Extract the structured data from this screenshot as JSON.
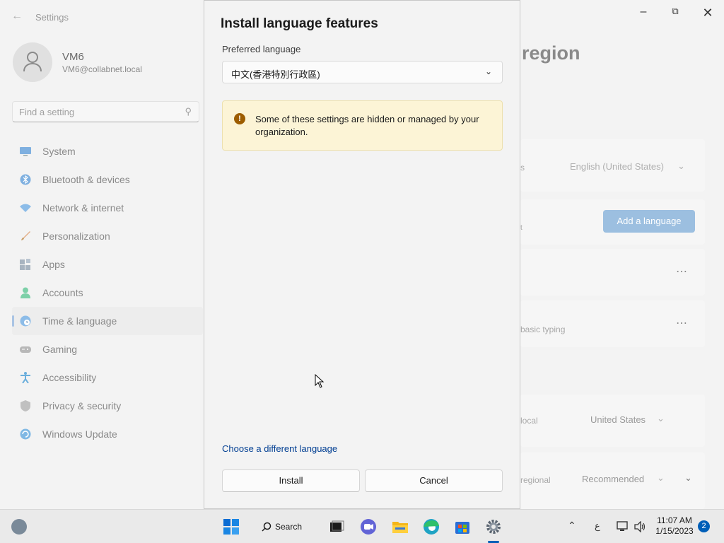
{
  "settings": {
    "app_title": "Settings",
    "user": {
      "name": "VM6",
      "email": "VM6@collabnet.local"
    },
    "search_placeholder": "Find a setting",
    "nav": [
      {
        "label": "System",
        "icon": "monitor-icon",
        "color": "#4a90d9"
      },
      {
        "label": "Bluetooth & devices",
        "icon": "bluetooth-icon",
        "color": "#0078d4"
      },
      {
        "label": "Network & internet",
        "icon": "wifi-icon",
        "color": "#2b8de0"
      },
      {
        "label": "Personalization",
        "icon": "brush-icon",
        "color": "#d98a4a"
      },
      {
        "label": "Apps",
        "icon": "apps-icon",
        "color": "#6b7b8c"
      },
      {
        "label": "Accounts",
        "icon": "person-icon",
        "color": "#2aa876"
      },
      {
        "label": "Time & language",
        "icon": "globe-clock-icon",
        "color": "#3a8fd9"
      },
      {
        "label": "Gaming",
        "icon": "gamepad-icon",
        "color": "#7a7a7a"
      },
      {
        "label": "Accessibility",
        "icon": "accessibility-icon",
        "color": "#2a8fd0"
      },
      {
        "label": "Privacy & security",
        "icon": "shield-icon",
        "color": "#8a8a8a"
      },
      {
        "label": "Windows Update",
        "icon": "update-icon",
        "color": "#2a8fd0"
      }
    ],
    "page_title_partial": "region",
    "cards": {
      "display_lang_fragment": "s",
      "display_lang_value": "English (United States)",
      "pref_lang_fragment": "t",
      "add_language": "Add a language",
      "typing_fragment": "basic typing",
      "country_fragment": "local",
      "country_value": "United States",
      "format_fragment": "regional",
      "format_value": "Recommended"
    }
  },
  "dialog": {
    "title": "Install language features",
    "preferred_label": "Preferred language",
    "selected_language": "中文(香港特別行政區)",
    "info_message": "Some of these settings are hidden or managed by your organization.",
    "choose_link": "Choose a different language",
    "install": "Install",
    "cancel": "Cancel"
  },
  "taskbar": {
    "search_label": "Search",
    "input_indicator": "ع",
    "time": "11:07 AM",
    "date": "1/15/2023",
    "notification_count": "2"
  }
}
